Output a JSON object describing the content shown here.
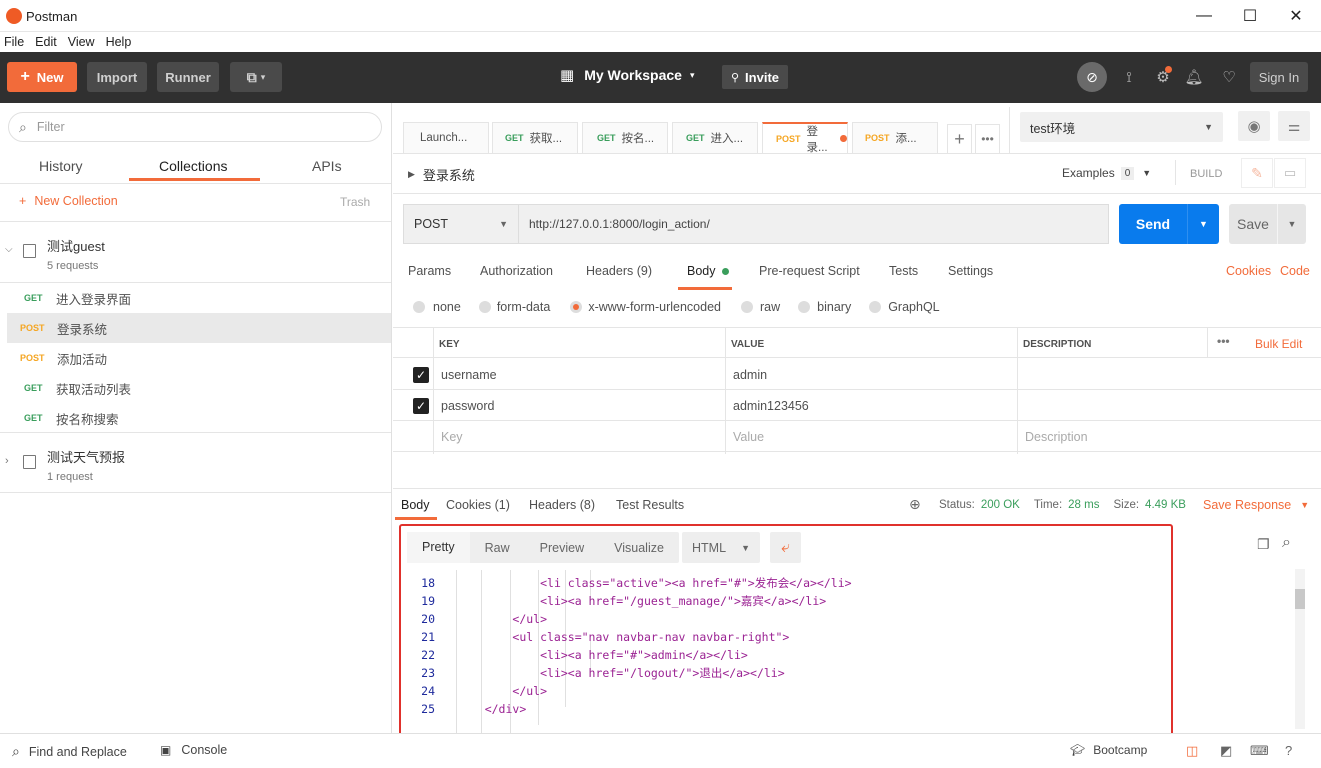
{
  "window": {
    "title": "Postman",
    "minimize": "—",
    "maximize": "☐",
    "close": "✕"
  },
  "menu": [
    "File",
    "Edit",
    "View",
    "Help"
  ],
  "toolbar": {
    "new_label": "New",
    "import_label": "Import",
    "runner_label": "Runner",
    "workspace_label": "My Workspace",
    "invite_label": "Invite",
    "signin_label": "Sign In"
  },
  "sidebar": {
    "filter_placeholder": "Filter",
    "tabs": [
      "History",
      "Collections",
      "APIs"
    ],
    "active_tab": "Collections",
    "new_collection_label": "New Collection",
    "trash_label": "Trash",
    "collections": [
      {
        "name": "测试guest",
        "meta": "5 requests",
        "expanded": true
      },
      {
        "name": "测试天气预报",
        "meta": "1 request",
        "expanded": false
      }
    ],
    "requests": [
      {
        "method": "GET",
        "name": "进入登录界面"
      },
      {
        "method": "POST",
        "name": "登录系统",
        "selected": true
      },
      {
        "method": "POST",
        "name": "添加活动"
      },
      {
        "method": "GET",
        "name": "获取活动列表"
      },
      {
        "method": "GET",
        "name": "按名称搜索"
      }
    ]
  },
  "request_tabs": [
    {
      "method": "",
      "label": "Launch..."
    },
    {
      "method": "GET",
      "label": "获取..."
    },
    {
      "method": "GET",
      "label": "按名..."
    },
    {
      "method": "GET",
      "label": "进入..."
    },
    {
      "method": "POST",
      "label": "登录...",
      "active": true
    },
    {
      "method": "POST",
      "label": "添..."
    }
  ],
  "environment": {
    "selected": "test环境"
  },
  "request": {
    "name": "登录系统",
    "examples_label": "Examples",
    "examples_count": "0",
    "build_label": "BUILD",
    "method": "POST",
    "url": "http://127.0.0.1:8000/login_action/",
    "send_label": "Send",
    "save_label": "Save",
    "subtabs": [
      "Params",
      "Authorization",
      "Headers (9)",
      "Body",
      "Pre-request Script",
      "Tests",
      "Settings"
    ],
    "cookies_label": "Cookies",
    "code_label": "Code",
    "body_types": [
      "none",
      "form-data",
      "x-www-form-urlencoded",
      "raw",
      "binary",
      "GraphQL"
    ],
    "selected_body_type": "x-www-form-urlencoded",
    "table": {
      "headers": [
        "KEY",
        "VALUE",
        "DESCRIPTION"
      ],
      "bulk_edit_label": "Bulk Edit",
      "rows": [
        {
          "key": "username",
          "value": "admin"
        },
        {
          "key": "password",
          "value": "admin123456"
        }
      ],
      "placeholder": {
        "key": "Key",
        "value": "Value",
        "description": "Description"
      }
    }
  },
  "response": {
    "tabs": [
      "Body",
      "Cookies (1)",
      "Headers (8)",
      "Test Results"
    ],
    "status_label": "Status:",
    "status_value": "200 OK",
    "time_label": "Time:",
    "time_value": "28 ms",
    "size_label": "Size:",
    "size_value": "4.49 KB",
    "save_response_label": "Save Response",
    "view_modes": [
      "Pretty",
      "Raw",
      "Preview",
      "Visualize"
    ],
    "format": "HTML",
    "lines": [
      {
        "n": "18",
        "indent": "            ",
        "code": "<li class=\"active\"><a href=\"#\">发布会</a></li>"
      },
      {
        "n": "19",
        "indent": "            ",
        "code": "<li><a href=\"/guest_manage/\">嘉宾</a></li>"
      },
      {
        "n": "20",
        "indent": "        ",
        "code": "</ul>"
      },
      {
        "n": "21",
        "indent": "        ",
        "code": "<ul class=\"nav navbar-nav navbar-right\">"
      },
      {
        "n": "22",
        "indent": "            ",
        "code": "<li><a href=\"#\">admin</a></li>"
      },
      {
        "n": "23",
        "indent": "            ",
        "code": "<li><a href=\"/logout/\">退出</a></li>"
      },
      {
        "n": "24",
        "indent": "        ",
        "code": "</ul>"
      },
      {
        "n": "25",
        "indent": "    ",
        "code": "</div>"
      }
    ]
  },
  "statusbar": {
    "find_replace_label": "Find and Replace",
    "console_label": "Console",
    "bootcamp_label": "Bootcamp"
  },
  "colors": {
    "accent": "#f26b3a",
    "send_blue": "#097bed",
    "get_green": "#3a9e5c",
    "post_orange": "#f5a623",
    "highlight_red": "#e0312c"
  }
}
